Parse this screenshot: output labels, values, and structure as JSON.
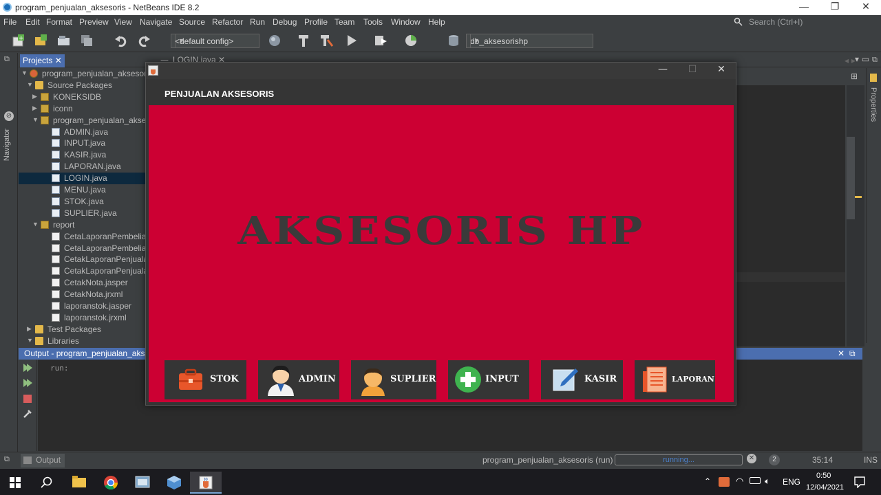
{
  "ide": {
    "window_title": "program_penjualan_aksesoris - NetBeans IDE 8.2",
    "menu": [
      "File",
      "Edit",
      "Format",
      "Preview",
      "View",
      "Navigate",
      "Source",
      "Refactor",
      "Run",
      "Debug",
      "Profile",
      "Team",
      "Tools",
      "Window",
      "Help"
    ],
    "search_placeholder": "Search (Ctrl+I)",
    "config_combo": "<default config>",
    "db_combo": "db_aksesorishp",
    "navigator_label": "Navigator",
    "properties_label": "Properties",
    "projects_tab": "Projects",
    "editor_tab": "LOGIN.java",
    "tree": [
      {
        "label": "program_penjualan_aksesoris",
        "depth": 0,
        "toggle": "▼",
        "icon": "project"
      },
      {
        "label": "Source Packages",
        "depth": 1,
        "toggle": "▼",
        "icon": "folder"
      },
      {
        "label": "KONEKSIDB",
        "depth": 2,
        "toggle": "▶",
        "icon": "package"
      },
      {
        "label": "iconn",
        "depth": 2,
        "toggle": "▶",
        "icon": "package"
      },
      {
        "label": "program_penjualan_aksesoris",
        "depth": 2,
        "toggle": "▼",
        "icon": "package"
      },
      {
        "label": "ADMIN.java",
        "depth": 3,
        "toggle": "",
        "icon": "java"
      },
      {
        "label": "INPUT.java",
        "depth": 3,
        "toggle": "",
        "icon": "java"
      },
      {
        "label": "KASIR.java",
        "depth": 3,
        "toggle": "",
        "icon": "java"
      },
      {
        "label": "LAPORAN.java",
        "depth": 3,
        "toggle": "",
        "icon": "java"
      },
      {
        "label": "LOGIN.java",
        "depth": 3,
        "toggle": "",
        "icon": "java",
        "selected": true
      },
      {
        "label": "MENU.java",
        "depth": 3,
        "toggle": "",
        "icon": "java"
      },
      {
        "label": "STOK.java",
        "depth": 3,
        "toggle": "",
        "icon": "java"
      },
      {
        "label": "SUPLIER.java",
        "depth": 3,
        "toggle": "",
        "icon": "java"
      },
      {
        "label": "report",
        "depth": 2,
        "toggle": "▼",
        "icon": "package"
      },
      {
        "label": "CetaLaporanPembelian.jasper",
        "depth": 3,
        "toggle": "",
        "icon": "jasper"
      },
      {
        "label": "CetaLaporanPembelian.jrxml",
        "depth": 3,
        "toggle": "",
        "icon": "jrxml"
      },
      {
        "label": "CetakLaporanPenjualan.jasper",
        "depth": 3,
        "toggle": "",
        "icon": "jasper"
      },
      {
        "label": "CetakLaporanPenjualan.jrxml",
        "depth": 3,
        "toggle": "",
        "icon": "jrxml"
      },
      {
        "label": "CetakNota.jasper",
        "depth": 3,
        "toggle": "",
        "icon": "jasper"
      },
      {
        "label": "CetakNota.jrxml",
        "depth": 3,
        "toggle": "",
        "icon": "jrxml"
      },
      {
        "label": "laporanstok.jasper",
        "depth": 3,
        "toggle": "",
        "icon": "jasper"
      },
      {
        "label": "laporanstok.jrxml",
        "depth": 3,
        "toggle": "",
        "icon": "jrxml"
      },
      {
        "label": "Test Packages",
        "depth": 1,
        "toggle": "▶",
        "icon": "folder"
      },
      {
        "label": "Libraries",
        "depth": 1,
        "toggle": "▼",
        "icon": "folder"
      }
    ],
    "output_title": "Output - program_penjualan_aksesoris (run)",
    "output_text": "run:",
    "status_output_tab": "Output",
    "status_run": "program_penjualan_aksesoris (run)",
    "progress_text": "running...",
    "notification_count": "2",
    "cursor_pos": "35:14",
    "insert_mode": "INS"
  },
  "app": {
    "header": "PENJUALAN AKSESORIS",
    "banner": "AKSESORIS HP",
    "buttons": [
      {
        "label": "STOK",
        "icon": "briefcase-icon"
      },
      {
        "label": "ADMIN",
        "icon": "admin-avatar-icon"
      },
      {
        "label": "SUPLIER",
        "icon": "supplier-avatar-icon"
      },
      {
        "label": "INPUT",
        "icon": "plus-icon"
      },
      {
        "label": "KASIR",
        "icon": "edit-note-icon"
      },
      {
        "label": "LAPORAN",
        "icon": "report-icon"
      }
    ],
    "colors": {
      "panel": "#cc0033",
      "button": "#353535",
      "banner_text": "#3a3a3a"
    }
  },
  "taskbar": {
    "language": "ENG",
    "time": "0:50",
    "date": "12/04/2021"
  }
}
